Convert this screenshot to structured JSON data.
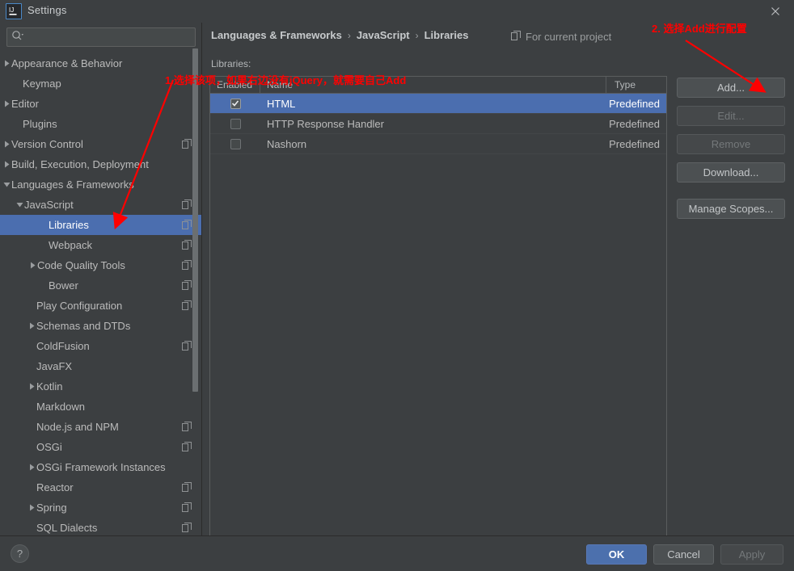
{
  "window": {
    "title": "Settings",
    "logo_icon": "intellij-idea-logo",
    "close_icon": "close-icon"
  },
  "search": {
    "value": "",
    "placeholder": "",
    "icon": "search-icon",
    "dropdown_icon": "chevron-down-icon"
  },
  "sidebar": {
    "scrollbar": "vertical-scrollbar",
    "items": [
      {
        "label": "Appearance & Behavior",
        "indent": 14,
        "arrow": "collapsed",
        "selected": false,
        "copy": false
      },
      {
        "label": "Keymap",
        "indent": 28,
        "arrow": "none",
        "selected": false,
        "copy": false
      },
      {
        "label": "Editor",
        "indent": 14,
        "arrow": "collapsed",
        "selected": false,
        "copy": false
      },
      {
        "label": "Plugins",
        "indent": 28,
        "arrow": "none",
        "selected": false,
        "copy": false
      },
      {
        "label": "Version Control",
        "indent": 14,
        "arrow": "collapsed",
        "selected": false,
        "copy": true
      },
      {
        "label": "Build, Execution, Deployment",
        "indent": 14,
        "arrow": "collapsed",
        "selected": false,
        "copy": false
      },
      {
        "label": "Languages & Frameworks",
        "indent": 14,
        "arrow": "expanded",
        "selected": false,
        "copy": false
      },
      {
        "label": "JavaScript",
        "indent": 30,
        "arrow": "expanded",
        "selected": false,
        "copy": true
      },
      {
        "label": "Libraries",
        "indent": 60,
        "arrow": "none",
        "selected": true,
        "copy": true
      },
      {
        "label": "Webpack",
        "indent": 60,
        "arrow": "none",
        "selected": false,
        "copy": true
      },
      {
        "label": "Code Quality Tools",
        "indent": 46,
        "arrow": "collapsed",
        "selected": false,
        "copy": true
      },
      {
        "label": "Bower",
        "indent": 60,
        "arrow": "none",
        "selected": false,
        "copy": true
      },
      {
        "label": "Play Configuration",
        "indent": 45,
        "arrow": "none",
        "selected": false,
        "copy": true
      },
      {
        "label": "Schemas and DTDs",
        "indent": 45,
        "arrow": "collapsed",
        "selected": false,
        "copy": false
      },
      {
        "label": "ColdFusion",
        "indent": 45,
        "arrow": "none",
        "selected": false,
        "copy": true
      },
      {
        "label": "JavaFX",
        "indent": 45,
        "arrow": "none",
        "selected": false,
        "copy": false
      },
      {
        "label": "Kotlin",
        "indent": 45,
        "arrow": "collapsed",
        "selected": false,
        "copy": false
      },
      {
        "label": "Markdown",
        "indent": 45,
        "arrow": "none",
        "selected": false,
        "copy": false
      },
      {
        "label": "Node.js and NPM",
        "indent": 45,
        "arrow": "none",
        "selected": false,
        "copy": true
      },
      {
        "label": "OSGi",
        "indent": 45,
        "arrow": "none",
        "selected": false,
        "copy": true
      },
      {
        "label": "OSGi Framework Instances",
        "indent": 45,
        "arrow": "collapsed",
        "selected": false,
        "copy": false
      },
      {
        "label": "Reactor",
        "indent": 45,
        "arrow": "none",
        "selected": false,
        "copy": true
      },
      {
        "label": "Spring",
        "indent": 45,
        "arrow": "collapsed",
        "selected": false,
        "copy": true
      },
      {
        "label": "SQL Dialects",
        "indent": 45,
        "arrow": "none",
        "selected": false,
        "copy": true
      }
    ]
  },
  "content": {
    "breadcrumb": [
      "Languages & Frameworks",
      "JavaScript",
      "Libraries"
    ],
    "breadcrumb_separator": "›",
    "scope": {
      "label": "For current project",
      "icon": "copy-module-icon"
    },
    "section_label": "Libraries:",
    "table": {
      "columns": [
        "Enabled",
        "Name",
        "Type"
      ],
      "rows": [
        {
          "enabled": true,
          "name": "HTML",
          "type": "Predefined",
          "selected": true
        },
        {
          "enabled": false,
          "name": "HTTP Response Handler",
          "type": "Predefined",
          "selected": false
        },
        {
          "enabled": false,
          "name": "Nashorn",
          "type": "Predefined",
          "selected": false
        }
      ]
    },
    "buttons": [
      {
        "label": "Add...",
        "disabled": false
      },
      {
        "label": "Edit...",
        "disabled": true
      },
      {
        "label": "Remove",
        "disabled": true
      },
      {
        "label": "Download...",
        "disabled": false
      },
      {
        "label": "Manage Scopes...",
        "disabled": false
      }
    ]
  },
  "footer": {
    "help_label": "?",
    "ok_label": "OK",
    "cancel_label": "Cancel",
    "apply_label": "Apply"
  },
  "annotations": [
    {
      "text": "1.选择该项，如果右边没有jQuery，就需要自己Add",
      "color": "#ff0000"
    },
    {
      "text": "2. 选择Add进行配置",
      "color": "#ff0000"
    }
  ],
  "colors": {
    "background": "#3c3f41",
    "selection_blue": "#4b6eaf",
    "accent_ok": "#4c70ad",
    "annotation_red": "#ff0000",
    "text": "#bbbbbb"
  }
}
